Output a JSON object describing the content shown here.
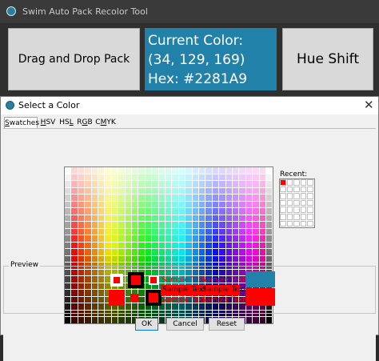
{
  "main_window": {
    "title": "Swim Auto Pack Recolor Tool",
    "drag_button": "Drag and Drop Pack",
    "current_color": {
      "line1": "Current Color:",
      "line2": "(34, 129, 169)",
      "line3": "Hex: #2281A9",
      "color": "#2281A9"
    },
    "hue_button": "Hue Shift"
  },
  "dialog": {
    "title": "Select a Color",
    "tabs": [
      {
        "label": "Swatches",
        "mnemonic": "S"
      },
      {
        "label": "HSV",
        "mnemonic": "H"
      },
      {
        "label": "HSL",
        "mnemonic": "L"
      },
      {
        "label": "RGB",
        "mnemonic": "G"
      },
      {
        "label": "CMYK",
        "mnemonic": "M"
      }
    ],
    "active_tab": "Swatches",
    "recent_label": "Recent:",
    "recent_colors": [
      "#ff0000"
    ],
    "preview": {
      "label": "Preview",
      "sample_text": "Sample Text",
      "color": "#ff0000",
      "previous_color": "#2281A9"
    },
    "buttons": {
      "ok": "OK",
      "cancel": "Cancel",
      "reset": "Reset"
    }
  }
}
